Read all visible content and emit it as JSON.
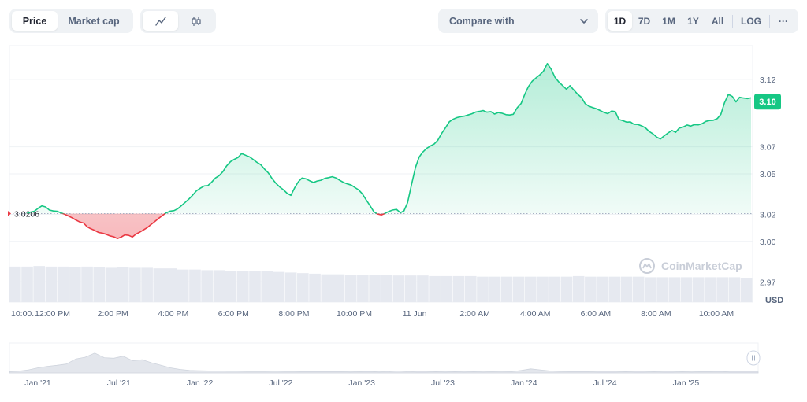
{
  "toolbar": {
    "metric_tabs": [
      "Price",
      "Market cap"
    ],
    "active_metric": "Price",
    "chart_types": [
      "line-chart-icon",
      "candlestick-icon"
    ],
    "active_chart_type": "line-chart-icon",
    "compare_label": "Compare with",
    "ranges": [
      "1D",
      "7D",
      "1M",
      "1Y",
      "All"
    ],
    "active_range": "1D",
    "log_label": "LOG",
    "more_label": "···"
  },
  "watermark": "CoinMarketCap",
  "colors": {
    "up": "#16c784",
    "down": "#ea3943",
    "grid": "#eff2f5",
    "axis_text": "#58667e"
  },
  "chart_data": [
    {
      "type": "line",
      "x": [
        0,
        0.12,
        0.25,
        0.38,
        0.5,
        0.62,
        0.75,
        0.88,
        1.0,
        1.12,
        1.25,
        1.38,
        1.5,
        1.62,
        1.75,
        1.88,
        2.0,
        2.12,
        2.25,
        2.38,
        2.5,
        2.62,
        2.75,
        2.88,
        3.0,
        3.12,
        3.25,
        3.38,
        3.5,
        3.62,
        3.75,
        3.88,
        4.0,
        4.12,
        4.25,
        4.38,
        4.5,
        4.62,
        4.75,
        4.88,
        5.0,
        5.12,
        5.25,
        5.38,
        5.5,
        5.62,
        5.75,
        5.88,
        6.0,
        6.12,
        6.25,
        6.38,
        6.5,
        6.62,
        6.75,
        6.88,
        7.0,
        7.12,
        7.25,
        7.38,
        7.5,
        7.62,
        7.75,
        7.88,
        8.0,
        8.12,
        8.25,
        8.38,
        8.5,
        8.62,
        8.75,
        8.88,
        9.0,
        9.12,
        9.25,
        9.38,
        9.5,
        9.62,
        9.75,
        9.88,
        10.0,
        10.12,
        10.25,
        10.38,
        10.5,
        10.62,
        10.75,
        10.88,
        11.0,
        11.12,
        11.25,
        11.38,
        11.5,
        11.62,
        11.75,
        11.88,
        12.0,
        12.12,
        12.25,
        12.38,
        12.5,
        12.62,
        12.75,
        12.88,
        13.0,
        13.12,
        13.25,
        13.38,
        13.5,
        13.62,
        13.75,
        13.88,
        14.0,
        14.12,
        14.25,
        14.38,
        14.5,
        14.62,
        14.75,
        14.88,
        15.0,
        15.12,
        15.25,
        15.38,
        15.5,
        15.62,
        15.75,
        15.88,
        16.0,
        16.12,
        16.25,
        16.38,
        16.5,
        16.62,
        16.75,
        16.88,
        17.0,
        17.12,
        17.25,
        17.38,
        17.5,
        17.62,
        17.75,
        17.88,
        18.0,
        18.12,
        18.25,
        18.38,
        18.5,
        18.62,
        18.75,
        18.88,
        19.0,
        19.12,
        19.25,
        19.38,
        19.5,
        19.62,
        19.75,
        19.88,
        20.0,
        20.12,
        20.25,
        20.38,
        20.5,
        20.62,
        20.75,
        20.88,
        21.0,
        21.12,
        21.25,
        21.38,
        21.5,
        21.62,
        21.75,
        21.88,
        22.0,
        22.12,
        22.25,
        22.38,
        22.5,
        22.62,
        22.75,
        22.88,
        23.0,
        23.12,
        23.25,
        23.38,
        23.5,
        23.62,
        23.75,
        23.88,
        24.0
      ],
      "y": [
        3.0206,
        3.0217,
        3.0223,
        3.0246,
        3.0263,
        3.0255,
        3.0232,
        3.0225,
        3.0223,
        3.0212,
        3.0201,
        3.0188,
        3.0175,
        3.0159,
        3.0144,
        3.0136,
        3.0108,
        3.0093,
        3.0081,
        3.0066,
        3.0061,
        3.0053,
        3.0041,
        3.0034,
        3.0021,
        3.0031,
        3.0048,
        3.0044,
        3.0032,
        3.0054,
        3.0069,
        3.0087,
        3.0103,
        3.0126,
        3.0148,
        3.0172,
        3.0193,
        3.0211,
        3.0224,
        3.0228,
        3.0241,
        3.0264,
        3.0289,
        3.0315,
        3.0343,
        3.0374,
        3.0394,
        3.0411,
        3.0413,
        3.0437,
        3.0469,
        3.0488,
        3.0517,
        3.0559,
        3.0591,
        3.0608,
        3.0621,
        3.0651,
        3.0638,
        3.0626,
        3.0607,
        3.0586,
        3.0568,
        3.0535,
        3.0508,
        3.0468,
        3.0431,
        3.0403,
        3.0383,
        3.0357,
        3.0341,
        3.0398,
        3.0442,
        3.0469,
        3.0463,
        3.0448,
        3.0436,
        3.0447,
        3.0453,
        3.0467,
        3.0472,
        3.0479,
        3.0469,
        3.0451,
        3.0436,
        3.0426,
        3.0417,
        3.0398,
        3.0381,
        3.0352,
        3.0306,
        3.0262,
        3.0219,
        3.0203,
        3.0196,
        3.0208,
        3.0222,
        3.0232,
        3.0237,
        3.0212,
        3.0226,
        3.0287,
        3.0421,
        3.0548,
        3.0624,
        3.0661,
        3.0689,
        3.0707,
        3.0721,
        3.0749,
        3.0801,
        3.0843,
        3.0886,
        3.0904,
        3.0917,
        3.0924,
        3.0928,
        3.0936,
        3.0945,
        3.0958,
        3.0963,
        3.0969,
        3.0957,
        3.0961,
        3.0943,
        3.0954,
        3.0949,
        3.0938,
        3.0936,
        3.0941,
        3.0989,
        3.1021,
        3.1088,
        3.1146,
        3.1187,
        3.1212,
        3.1234,
        3.1261,
        3.1317,
        3.1274,
        3.1216,
        3.1183,
        3.1155,
        3.1127,
        3.1154,
        3.1123,
        3.1091,
        3.1066,
        3.1021,
        3.1002,
        3.0991,
        3.0982,
        3.0969,
        3.0956,
        3.0946,
        3.0965,
        3.0961,
        3.0903,
        3.0894,
        3.0883,
        3.0885,
        3.0867,
        3.0866,
        3.0855,
        3.0841,
        3.0815,
        3.0796,
        3.0771,
        3.0759,
        3.0781,
        3.0803,
        3.0822,
        3.0808,
        3.0839,
        3.0847,
        3.0862,
        3.0854,
        3.0865,
        3.0863,
        3.0872,
        3.0889,
        3.0895,
        3.0897,
        3.0909,
        3.0941,
        3.1027,
        3.1089,
        3.1073,
        3.1033,
        3.1067,
        3.1062,
        3.1058,
        3.1063,
        3.1078,
        3.1071,
        3.1083,
        3.1091,
        3.1088,
        3.1079,
        3.1089,
        3.1065,
        3.1048,
        3.1035
      ],
      "baseline": 3.0206,
      "baseline_label": "3.0206",
      "last_label": "3.10",
      "ylim": [
        2.955,
        3.145
      ],
      "yticks": [
        3.12,
        3.07,
        3.05,
        3.02,
        3.0,
        2.97
      ],
      "ytick_labels": [
        "3.12",
        "3.07",
        "3.05",
        "3.02",
        "3.00",
        "2.97"
      ],
      "xtick_positions": [
        2,
        4,
        6,
        8,
        10,
        12,
        14,
        16,
        18,
        20,
        22,
        24
      ],
      "xtick_labels": [
        "12:00 PM",
        "2:00 PM",
        "4:00 PM",
        "6:00 PM",
        "8:00 PM",
        "10:00 PM",
        "11 Jun",
        "2:00 AM",
        "4:00 AM",
        "6:00 AM",
        "8:00 AM",
        "10:00 AM"
      ],
      "first_label": "10:00...",
      "y_unit": "USD",
      "volume": [
        0.6,
        0.6,
        0.61,
        0.6,
        0.6,
        0.59,
        0.6,
        0.59,
        0.58,
        0.59,
        0.58,
        0.58,
        0.57,
        0.57,
        0.55,
        0.55,
        0.54,
        0.54,
        0.53,
        0.52,
        0.53,
        0.52,
        0.51,
        0.5,
        0.49,
        0.48,
        0.47,
        0.47,
        0.46,
        0.46,
        0.46,
        0.46,
        0.45,
        0.45,
        0.45,
        0.44,
        0.44,
        0.44,
        0.44,
        0.43,
        0.43,
        0.43,
        0.43,
        0.43,
        0.43,
        0.43,
        0.43,
        0.44,
        0.43,
        0.43,
        0.43,
        0.43,
        0.43,
        0.42,
        0.42,
        0.42,
        0.42,
        0.42,
        0.42,
        0.42,
        0.42,
        0.41
      ]
    },
    {
      "type": "area",
      "x_labels": [
        "Jan '21",
        "Jul '21",
        "Jan '22",
        "Jul '22",
        "Jan '23",
        "Jul '23",
        "Jan '24",
        "Jul '24",
        "Jan '25"
      ],
      "values": [
        0.05,
        0.07,
        0.12,
        0.2,
        0.26,
        0.3,
        0.35,
        0.55,
        0.62,
        0.78,
        0.6,
        0.58,
        0.66,
        0.48,
        0.52,
        0.4,
        0.3,
        0.2,
        0.14,
        0.1,
        0.09,
        0.08,
        0.08,
        0.07,
        0.07,
        0.06,
        0.06,
        0.06,
        0.07,
        0.06,
        0.06,
        0.05,
        0.05,
        0.05,
        0.05,
        0.05,
        0.04,
        0.05,
        0.06,
        0.04,
        0.05,
        0.08,
        0.05,
        0.04,
        0.04,
        0.05,
        0.04,
        0.05,
        0.04,
        0.05,
        0.04,
        0.05,
        0.06,
        0.05,
        0.1,
        0.16,
        0.12,
        0.08,
        0.06,
        0.05,
        0.05,
        0.05,
        0.04,
        0.04,
        0.04,
        0.05,
        0.04,
        0.04,
        0.05,
        0.04,
        0.04,
        0.05,
        0.04,
        0.05,
        0.05,
        0.06,
        0.04,
        0.04,
        0.04,
        0.04
      ]
    }
  ]
}
